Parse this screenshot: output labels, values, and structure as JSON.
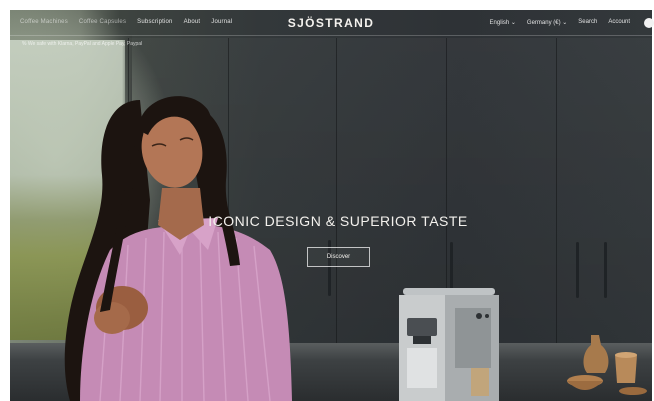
{
  "nav": {
    "left_items": [
      {
        "label": "Coffee Machines",
        "dim": true
      },
      {
        "label": "Coffee Capsules",
        "dim": true
      },
      {
        "label": "Subscription",
        "dim": false
      },
      {
        "label": "About",
        "dim": false
      },
      {
        "label": "Journal",
        "dim": false
      }
    ],
    "logo": "SJÖSTRAND",
    "language": "English ⌄",
    "region": "Germany (€) ⌄",
    "search": "Search",
    "account": "Account"
  },
  "announcement": "% We safe with Klarna, PayPal and Apple Pay, Paypal",
  "hero": {
    "title": "ICONIC DESIGN & SUPERIOR TASTE",
    "cta": "Discover"
  }
}
